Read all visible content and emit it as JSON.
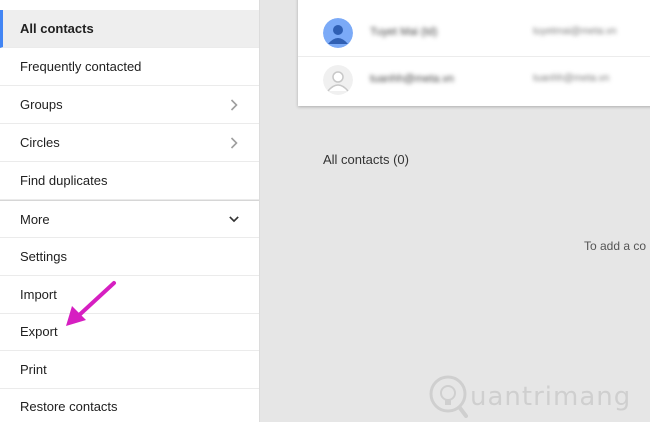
{
  "sidebar": {
    "items": [
      {
        "label": "All contacts"
      },
      {
        "label": "Frequently contacted"
      },
      {
        "label": "Groups"
      },
      {
        "label": "Circles"
      },
      {
        "label": "Find duplicates"
      },
      {
        "label": "More"
      },
      {
        "label": "Settings"
      },
      {
        "label": "Import"
      },
      {
        "label": "Export"
      },
      {
        "label": "Print"
      },
      {
        "label": "Restore contacts"
      }
    ]
  },
  "contacts_card": {
    "rows": [
      {
        "name": "Tuyet Mai (td)",
        "email": "tuyetmai@meta.vn",
        "avatar": "person-avatar-blue"
      },
      {
        "name": "tuanhh@meta.vn",
        "email": "tuanhh@meta.vn",
        "avatar": "person-avatar-gray"
      }
    ]
  },
  "main": {
    "count_label": "All contacts (0)",
    "hint": "To add a co"
  },
  "watermark": {
    "text": "uantrimang"
  },
  "colors": {
    "accent": "#4285f4",
    "arrow": "#d61fc1"
  }
}
